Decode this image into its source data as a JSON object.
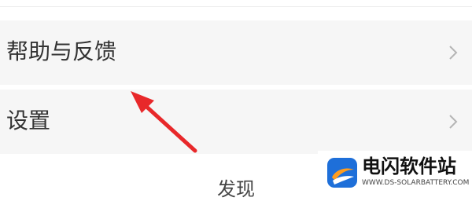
{
  "menu": {
    "items": [
      {
        "label": "帮助与反馈",
        "icon": "chevron-right-icon"
      },
      {
        "label": "设置",
        "icon": "chevron-right-icon"
      }
    ]
  },
  "bottom_nav": {
    "label": "发现"
  },
  "annotation": {
    "icon": "red-arrow-icon",
    "color": "#e8282a"
  },
  "watermark": {
    "title": "电闪软件站",
    "url": "WWW.DS-SOLARBATTERY.COM",
    "logo_colors": [
      "#1e6fd9",
      "#ff9d1e"
    ]
  }
}
